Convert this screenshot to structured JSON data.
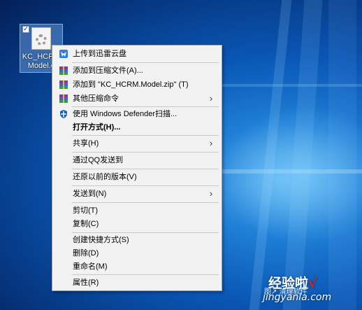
{
  "desktop_file": {
    "name": "KC_HCRM\nModel.c"
  },
  "context_menu": {
    "items": [
      {
        "label": "上传到迅雷云盘",
        "icon": "thunder-cloud-icon"
      },
      {
        "label": "添加到压缩文件(A)...",
        "icon": "winrar-archive-icon"
      },
      {
        "label": "添加到 \"KC_HCRM.Model.zip\" (T)",
        "icon": "winrar-archive-icon"
      },
      {
        "label": "其他压缩命令",
        "icon": "winrar-archive-icon",
        "submenu": true
      },
      {
        "label": "使用 Windows Defender扫描...",
        "icon": "windows-defender-shield-icon"
      },
      {
        "label": "打开方式(H)...",
        "bold": true
      },
      {
        "label": "共享(H)",
        "submenu": true
      },
      {
        "label": "通过QQ发送到"
      },
      {
        "label": "还原以前的版本(V)"
      },
      {
        "label": "发送到(N)",
        "submenu": true
      },
      {
        "label": "剪切(T)"
      },
      {
        "label": "复制(C)"
      },
      {
        "label": "创建快捷方式(S)"
      },
      {
        "label": "删除(D)"
      },
      {
        "label": "重命名(M)"
      },
      {
        "label": "属性(R)"
      }
    ]
  },
  "watermark": {
    "logo": "经验啦",
    "check": "√",
    "sub": "图↗ 清理软件",
    "url": "jingyanla.com"
  },
  "colors": {
    "menu_bg": "#f2f2f2",
    "desktop_accent": "#0a57b6",
    "watermark_check": "#e02020"
  }
}
